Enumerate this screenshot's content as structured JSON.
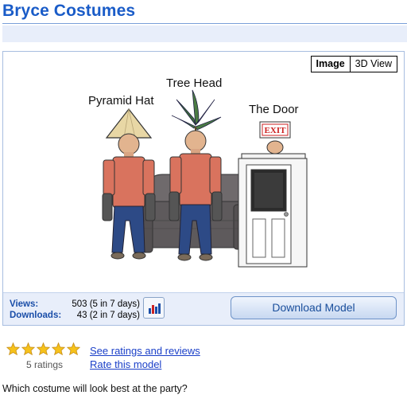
{
  "page": {
    "title": "Bryce Costumes"
  },
  "viewer": {
    "tabs": [
      {
        "label": "Image",
        "active": true
      },
      {
        "label": "3D View",
        "active": false
      }
    ],
    "labels": {
      "pyramid_hat": "Pyramid Hat",
      "tree_head": "Tree Head",
      "the_door": "The Door",
      "exit_sign": "EXIT"
    }
  },
  "stats": {
    "views_label": "Views:",
    "views_value": "503 (5 in 7 days)",
    "downloads_label": "Downloads:",
    "downloads_value": "43 (2 in 7 days)"
  },
  "download": {
    "label": "Download Model"
  },
  "ratings": {
    "stars_filled": 5,
    "stars_total": 5,
    "count_text": "5 ratings",
    "see_reviews_link": "See ratings and reviews",
    "rate_link": "Rate this model"
  },
  "description": "Which costume will look best at the party?",
  "colors": {
    "title": "#1a5cc8",
    "link": "#1a3fc8",
    "star": "#f6c21b",
    "star_outline": "#c8901a",
    "panel_bg": "#e8eefa",
    "shirt": "#d9735e",
    "pants": "#2d4a86"
  }
}
